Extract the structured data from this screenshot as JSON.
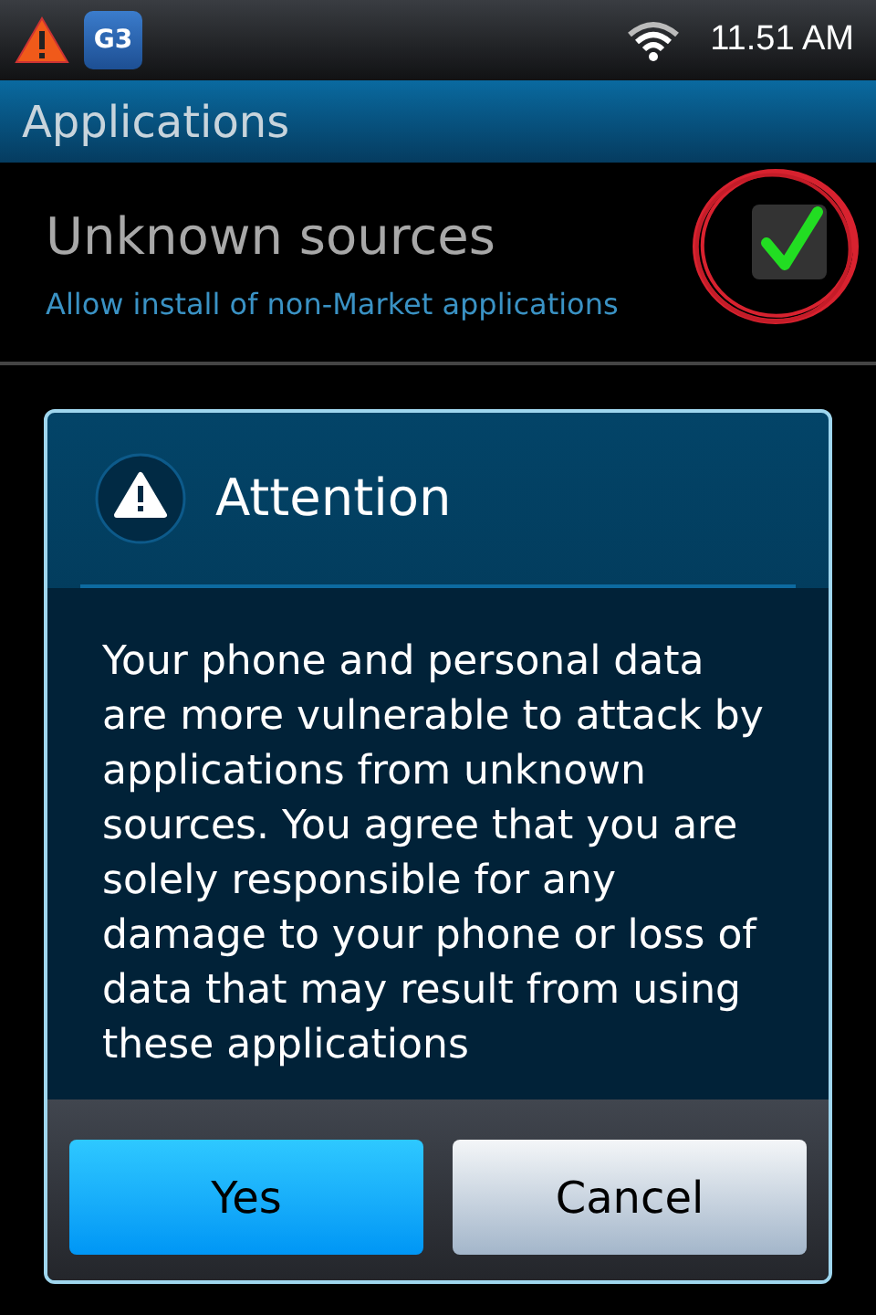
{
  "status_bar": {
    "time": "11.51 AM",
    "notification_badge": "G3"
  },
  "title_bar": {
    "title": "Applications"
  },
  "setting": {
    "title": "Unknown sources",
    "summary": "Allow install of non-Market applications",
    "checked": true,
    "annotated": true
  },
  "dialog": {
    "title": "Attention",
    "message": "Your phone and personal data are more vulnerable to attack by applications from unknown sources. You agree that you are solely responsible for any damage to your phone or loss of data that may result from using these applications",
    "buttons": [
      {
        "label": "Yes",
        "selected": true
      },
      {
        "label": "Cancel",
        "selected": false
      }
    ]
  }
}
